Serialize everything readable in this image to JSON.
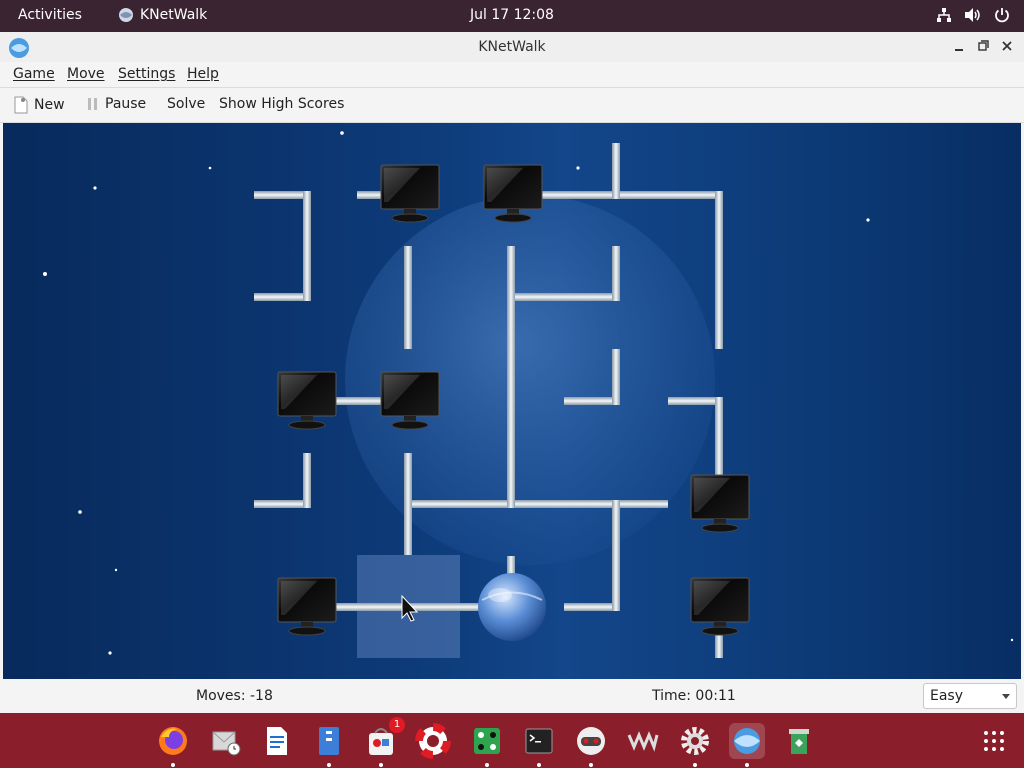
{
  "topbar": {
    "activities": "Activities",
    "app_name": "KNetWalk",
    "clock": "Jul 17  12:08"
  },
  "window": {
    "title": "KNetWalk"
  },
  "menu": {
    "game": "Game",
    "move": "Move",
    "settings": "Settings",
    "help": "Help"
  },
  "toolbar": {
    "new": "New",
    "pause": "Pause",
    "solve": "Solve",
    "high_scores": "Show High Scores"
  },
  "status": {
    "moves": "Moves: -18",
    "time": "Time: 00:11",
    "difficulty": "Easy"
  },
  "dock": {
    "notification_count": "1"
  },
  "colors": {
    "topbar": "#3b2431",
    "dock": "#8a1e2a",
    "board": "#0d3a78"
  }
}
